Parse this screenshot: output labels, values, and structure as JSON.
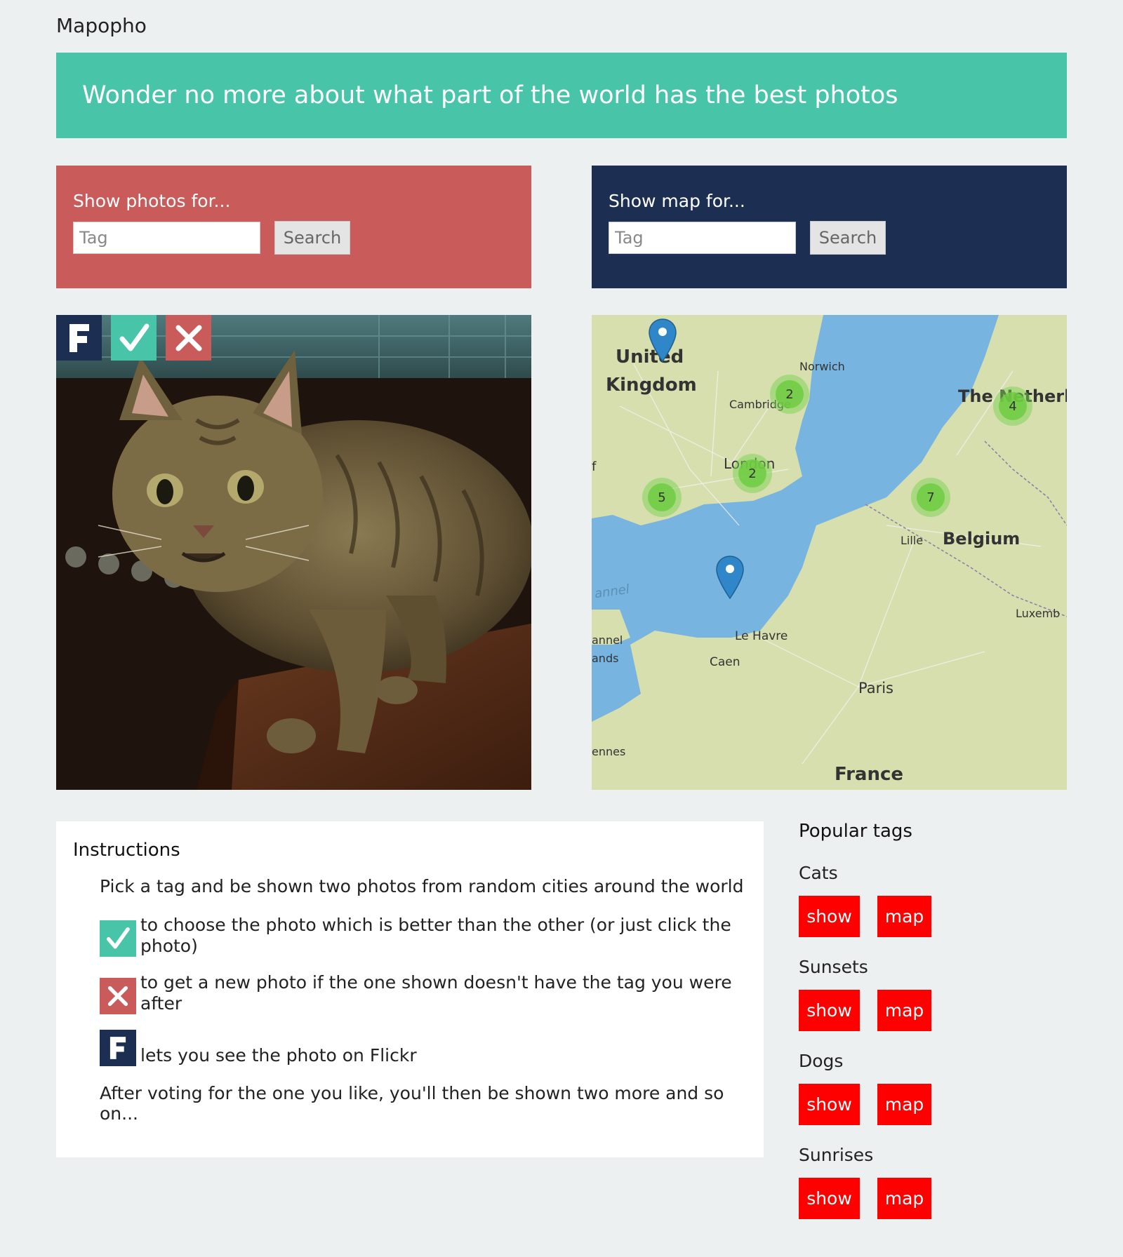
{
  "app": {
    "title": "Mapopho"
  },
  "hero": {
    "text": "Wonder no more about what part of the world has the best photos"
  },
  "photos_panel": {
    "heading": "Show photos for...",
    "input_placeholder": "Tag",
    "search_label": "Search"
  },
  "map_panel": {
    "heading": "Show map for...",
    "input_placeholder": "Tag",
    "search_label": "Search"
  },
  "photo": {
    "controls": [
      {
        "icon": "flickr-f-icon"
      },
      {
        "icon": "check-icon"
      },
      {
        "icon": "cross-icon"
      }
    ]
  },
  "map": {
    "labels": {
      "united": "United",
      "kingdom": "Kingdom",
      "norwich": "Norwich",
      "cambridge": "Cambridge",
      "london": "London",
      "netherlands": "The Netherla",
      "belgium": "Belgium",
      "lille": "Lille",
      "luxembourg": "Luxemb",
      "le_havre": "Le Havre",
      "caen": "Caen",
      "paris": "Paris",
      "france": "France",
      "channel": "annel",
      "channel_islands_1": "annel",
      "channel_islands_2": "ands",
      "rennes": "ennes",
      "f_edge": "f"
    },
    "clusters": [
      "2",
      "4",
      "2",
      "5",
      "7"
    ]
  },
  "instructions": {
    "title": "Instructions",
    "intro": "Pick a tag and be shown two photos from random cities around the world",
    "choose": "to choose the photo which is better than the other (or just click the photo)",
    "new_photo": "to get a new photo if the one shown doesn't have the tag you were after",
    "flickr": "lets you see the photo on Flickr",
    "outro": "After voting for the one you like, you'll then be shown two more and so on..."
  },
  "popular": {
    "title": "Popular tags",
    "tags": [
      {
        "name": "Cats",
        "show": "show",
        "map": "map"
      },
      {
        "name": "Sunsets",
        "show": "show",
        "map": "map"
      },
      {
        "name": "Dogs",
        "show": "show",
        "map": "map"
      },
      {
        "name": "Sunrises",
        "show": "show",
        "map": "map"
      }
    ]
  },
  "colors": {
    "teal": "#48c4a8",
    "red_panel": "#c95c5a",
    "navy": "#1c2f52",
    "tag_button": "#ff0000"
  }
}
